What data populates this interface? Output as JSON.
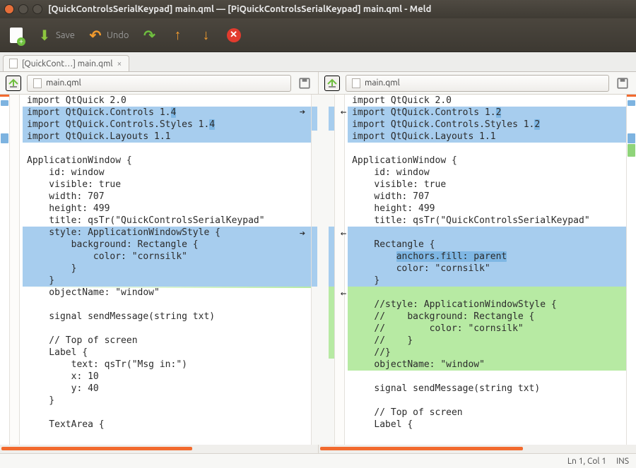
{
  "window": {
    "title": "[QuickControlsSerialKeypad] main.qml — [PiQuickControlsSerialKeypad] main.qml - Meld"
  },
  "toolbar": {
    "save_label": "Save",
    "undo_label": "Undo"
  },
  "tab": {
    "label": "[QuickCont…] main.qml"
  },
  "files": {
    "left": "main.qml",
    "right": "main.qml"
  },
  "left_lines": [
    "import QtQuick 2.0",
    "import QtQuick.Controls 1.4",
    "import QtQuick.Controls.Styles 1.4",
    "import QtQuick.Layouts 1.1",
    "",
    "ApplicationWindow {",
    "    id: window",
    "    visible: true",
    "    width: 707",
    "    height: 499",
    "    title: qsTr(\"QuickControlsSerialKeypad\"",
    "    style: ApplicationWindowStyle {",
    "        background: Rectangle {",
    "            color: \"cornsilk\"",
    "        }",
    "    }",
    "    objectName: \"window\"",
    "",
    "    signal sendMessage(string txt)",
    "",
    "    // Top of screen",
    "    Label {",
    "        text: qsTr(\"Msg in:\")",
    "        x: 10",
    "        y: 40",
    "    }",
    "",
    "    TextArea {"
  ],
  "left_token_hl": {
    "1": [
      26,
      27
    ],
    "2": [
      33,
      34
    ]
  },
  "right_lines": [
    "import QtQuick 2.0",
    "import QtQuick.Controls 1.2",
    "import QtQuick.Controls.Styles 1.2",
    "import QtQuick.Layouts 1.1",
    "",
    "ApplicationWindow {",
    "    id: window",
    "    visible: true",
    "    width: 707",
    "    height: 499",
    "    title: qsTr(\"QuickControlsSerialKeypad\"",
    "",
    "    Rectangle {",
    "        anchors.fill: parent",
    "        color: \"cornsilk\"",
    "    }",
    "",
    "    //style: ApplicationWindowStyle {",
    "    //    background: Rectangle {",
    "    //        color: \"cornsilk\"",
    "    //    }",
    "    //}",
    "    objectName: \"window\"",
    "",
    "    signal sendMessage(string txt)",
    "",
    "    // Top of screen",
    "    Label {"
  ],
  "right_token_hl": {
    "1": [
      26,
      27
    ],
    "2": [
      33,
      34
    ],
    "13": [
      8,
      28
    ]
  },
  "diff": {
    "left": {
      "blue": [
        [
          1,
          3
        ],
        [
          11,
          15
        ]
      ],
      "green_insert_at": 16
    },
    "right": {
      "blue": [
        [
          1,
          3
        ],
        [
          11,
          16
        ]
      ],
      "green": [
        [
          16,
          22
        ]
      ]
    }
  },
  "status": {
    "pos": "Ln 1, Col 1",
    "mode": "INS"
  },
  "scroll": {
    "left_thumb_pct": 60,
    "right_thumb_pct": 64
  }
}
